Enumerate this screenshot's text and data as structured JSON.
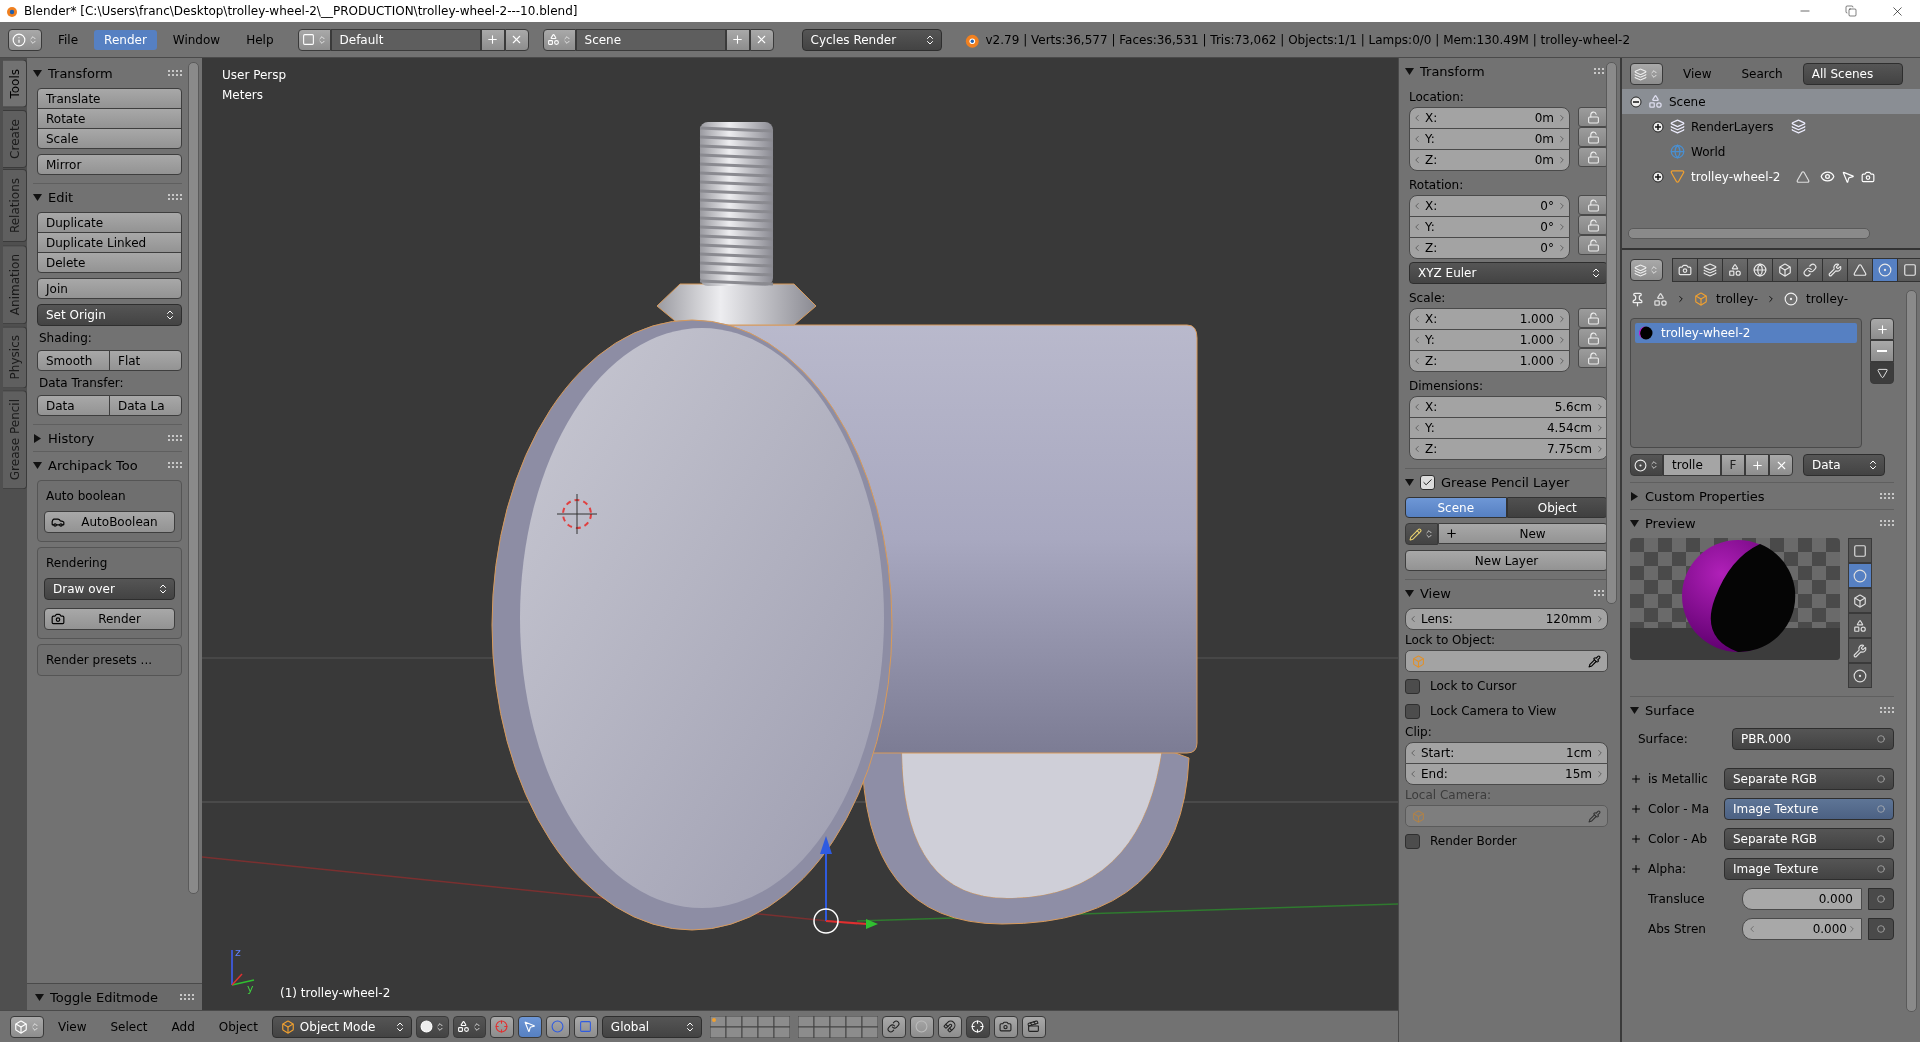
{
  "window": {
    "title": "Blender* [C:\\Users\\franc\\Desktop\\trolley-wheel-2\\__PRODUCTION\\trolley-wheel-2---10.blend]"
  },
  "info_header": {
    "menus": [
      {
        "label": "File",
        "selected": false
      },
      {
        "label": "Render",
        "selected": true
      },
      {
        "label": "Window",
        "selected": false
      },
      {
        "label": "Help",
        "selected": false
      }
    ],
    "layout": "Default",
    "scene": "Scene",
    "engine": "Cycles Render",
    "stats": "v2.79 | Verts:36,577 | Faces:36,531 | Tris:73,062 | Objects:1/1 | Lamps:0/0 | Mem:130.49M | trolley-wheel-2"
  },
  "tool_tabs": [
    {
      "label": "Tools",
      "selected": true
    },
    {
      "label": "Create",
      "selected": false
    },
    {
      "label": "Relations",
      "selected": false
    },
    {
      "label": "Animation",
      "selected": false
    },
    {
      "label": "Physics",
      "selected": false
    },
    {
      "label": "Grease Pencil",
      "selected": false
    }
  ],
  "tool_shelf": {
    "sections": [
      {
        "title": "Transform",
        "expanded": true,
        "items": [
          {
            "kind": "buttons",
            "labels": [
              "Translate",
              "Rotate",
              "Scale"
            ]
          },
          {
            "kind": "buttons",
            "labels": [
              "Mirror"
            ]
          }
        ]
      },
      {
        "title": "Edit",
        "expanded": true,
        "items": [
          {
            "kind": "buttons",
            "labels": [
              "Duplicate",
              "Duplicate Linked",
              "Delete"
            ]
          },
          {
            "kind": "buttons",
            "labels": [
              "Join"
            ]
          },
          {
            "kind": "dropdown",
            "value": "Set Origin"
          },
          {
            "kind": "label",
            "text": "Shading:"
          },
          {
            "kind": "row",
            "labels": [
              "Smooth",
              "Flat"
            ]
          },
          {
            "kind": "label",
            "text": "Data Transfer:"
          },
          {
            "kind": "row",
            "labels": [
              "Data",
              "Data La"
            ]
          }
        ]
      },
      {
        "title": "History",
        "expanded": false
      },
      {
        "title": "Archipack Too",
        "expanded": true,
        "items": [
          {
            "kind": "box",
            "items": [
              {
                "kind": "label",
                "text": "Auto boolean"
              },
              {
                "kind": "icon_button",
                "label": "AutoBoolean"
              }
            ]
          },
          {
            "kind": "box",
            "items": [
              {
                "kind": "label",
                "text": "Rendering"
              },
              {
                "kind": "dropdown",
                "value": "Draw over"
              },
              {
                "kind": "icon_button",
                "label": "Render"
              }
            ]
          },
          {
            "kind": "box",
            "items": [
              {
                "kind": "label",
                "text": "Render presets ..."
              }
            ]
          }
        ]
      }
    ],
    "operator_panel": {
      "title": "Toggle Editmode",
      "expanded": true
    }
  },
  "viewport": {
    "view_name": "User Persp",
    "units": "Meters",
    "object_label": "(1) trolley-wheel-2",
    "axis_labels": [
      "z",
      "y"
    ]
  },
  "bottom_header": {
    "menus": [
      "View",
      "Select",
      "Add",
      "Object"
    ],
    "mode": "Object Mode",
    "orientation": "Global"
  },
  "n_panel": {
    "transform": {
      "title": "Transform",
      "expanded": true,
      "groups": [
        {
          "label": "Location:",
          "kind": "lockable",
          "fields": [
            {
              "axis": "X:",
              "value": "0m",
              "locked": false
            },
            {
              "axis": "Y:",
              "value": "0m",
              "locked": false
            },
            {
              "axis": "Z:",
              "value": "0m",
              "locked": false
            }
          ]
        },
        {
          "label": "Rotation:",
          "kind": "lockable",
          "fields": [
            {
              "axis": "X:",
              "value": "0°",
              "locked": false
            },
            {
              "axis": "Y:",
              "value": "0°",
              "locked": false
            },
            {
              "axis": "Z:",
              "value": "0°",
              "locked": false
            }
          ],
          "mode": "XYZ Euler"
        },
        {
          "label": "Scale:",
          "kind": "lockable",
          "fields": [
            {
              "axis": "X:",
              "value": "1.000",
              "locked": false
            },
            {
              "axis": "Y:",
              "value": "1.000",
              "locked": false
            },
            {
              "axis": "Z:",
              "value": "1.000",
              "locked": false
            }
          ]
        },
        {
          "label": "Dimensions:",
          "kind": "plain",
          "fields": [
            {
              "axis": "X:",
              "value": "5.6cm"
            },
            {
              "axis": "Y:",
              "value": "4.54cm"
            },
            {
              "axis": "Z:",
              "value": "7.75cm"
            }
          ]
        }
      ]
    },
    "grease_pencil": {
      "title": "Grease Pencil Layer",
      "expanded": true,
      "checked": true,
      "tabs": [
        {
          "label": "Scene",
          "selected": true
        },
        {
          "label": "Object",
          "selected": false
        }
      ],
      "new_button": "New",
      "new_layer_button": "New Layer"
    },
    "view": {
      "title": "View",
      "expanded": true,
      "lens": {
        "label": "Lens:",
        "value": "120mm"
      },
      "lock_label": "Lock to Object:",
      "checkboxes": [
        {
          "label": "Lock to Cursor",
          "checked": false
        },
        {
          "label": "Lock Camera to View",
          "checked": false
        }
      ],
      "clip_label": "Clip:",
      "clip": [
        {
          "label": "Start:",
          "value": "1cm"
        },
        {
          "label": "End:",
          "value": "15m"
        }
      ],
      "local_camera": {
        "label": "Local Camera:",
        "disabled": true
      },
      "render_border": {
        "label": "Render Border",
        "checked": false
      }
    }
  },
  "outliner": {
    "menus": [
      "View",
      "Search"
    ],
    "display": "All Scenes",
    "tree": [
      {
        "label": "Scene",
        "kind": "scene",
        "expanded": true,
        "selected": true,
        "children": [
          {
            "label": "RenderLayers",
            "kind": "render_layers",
            "expanded": false,
            "selected": false
          },
          {
            "label": "World",
            "kind": "world",
            "selected": false
          },
          {
            "label": "trolley-wheel-2",
            "kind": "mesh_object",
            "expanded": false,
            "selected": false
          }
        ]
      }
    ]
  },
  "properties": {
    "context_tabs": [
      {
        "selected": false
      },
      {
        "selected": false
      },
      {
        "selected": false
      },
      {
        "selected": false
      },
      {
        "selected": false
      },
      {
        "selected": false
      },
      {
        "selected": false
      },
      {
        "selected": false
      },
      {
        "selected": true
      },
      {
        "selected": false
      }
    ],
    "breadcrumb": [
      "trolley-",
      "trolley-"
    ],
    "material_slots": [
      {
        "name": "trolley-wheel-2",
        "selected": true
      }
    ],
    "material_id": {
      "name": "trolle",
      "fake_user": "F",
      "link": "Data"
    },
    "custom_properties": {
      "title": "Custom Properties",
      "expanded": false
    },
    "preview": {
      "title": "Preview",
      "expanded": true,
      "types": [
        {
          "selected": false
        },
        {
          "selected": true
        },
        {
          "selected": false
        },
        {
          "selected": false
        },
        {
          "selected": false
        },
        {
          "selected": false
        }
      ]
    },
    "surface": {
      "title": "Surface",
      "expanded": true,
      "rows": [
        {
          "kind": "node",
          "label": "Surface:",
          "value": "PBR.000"
        },
        {
          "kind": "linked",
          "label": "is Metallic",
          "value": "Separate RGB",
          "highlighted": false
        },
        {
          "kind": "linked",
          "label": "Color - Ma",
          "value": "Image Texture",
          "highlighted": true
        },
        {
          "kind": "linked",
          "label": "Color - Ab",
          "value": "Separate RGB",
          "highlighted": false
        },
        {
          "kind": "linked",
          "label": "Alpha:",
          "value": "Image Texture",
          "highlighted": false
        },
        {
          "kind": "slider",
          "label": "Transluce",
          "value": "0.000",
          "level": 0
        },
        {
          "kind": "number",
          "label": "Abs Stren",
          "value": "0.000"
        }
      ]
    }
  }
}
